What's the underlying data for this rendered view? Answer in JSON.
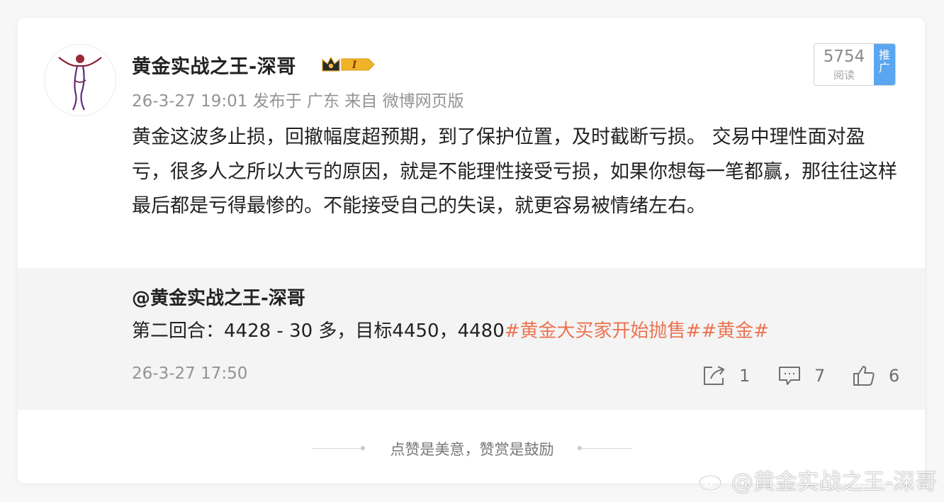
{
  "post": {
    "author": "黄金实战之王-深哥",
    "badge_level": "I",
    "meta": "26-3-27 19:01 发布于 广东 来自 微博网页版",
    "read_count": "5754",
    "read_label": "阅读",
    "promote_label": "推广",
    "text": "黄金这波多止损，回撤幅度超预期，到了保护位置，及时截断亏损。 交易中理性面对盈亏，很多人之所以大亏的原因，就是不能理性接受亏损，如果你想每一笔都赢，那往往这样最后都是亏得最惨的。不能接受自己的失误，就更容易被情绪左右。"
  },
  "repost": {
    "author": "@黄金实战之王-深哥",
    "text_plain": "第二回合：4428 - 30 多，目标4450，4480",
    "hashtags": "#黄金大买家开始抛售##黄金#",
    "time": "26-3-27 17:50",
    "share_count": "1",
    "comment_count": "7",
    "like_count": "6"
  },
  "footer": {
    "text": "点赞是美意，赞赏是鼓励"
  },
  "watermark": {
    "text": "@黄金实战之王-深哥"
  },
  "colors": {
    "hashtag": "#eb7350",
    "promote": "#5aa6f0",
    "repost_bg": "#f4f4f4",
    "meta_text": "#939393"
  },
  "icons": {
    "share": "share-icon",
    "comment": "comment-icon",
    "like": "thumbs-up-icon",
    "badge": "crown-badge-icon",
    "watermark": "weibo-logo-icon"
  }
}
